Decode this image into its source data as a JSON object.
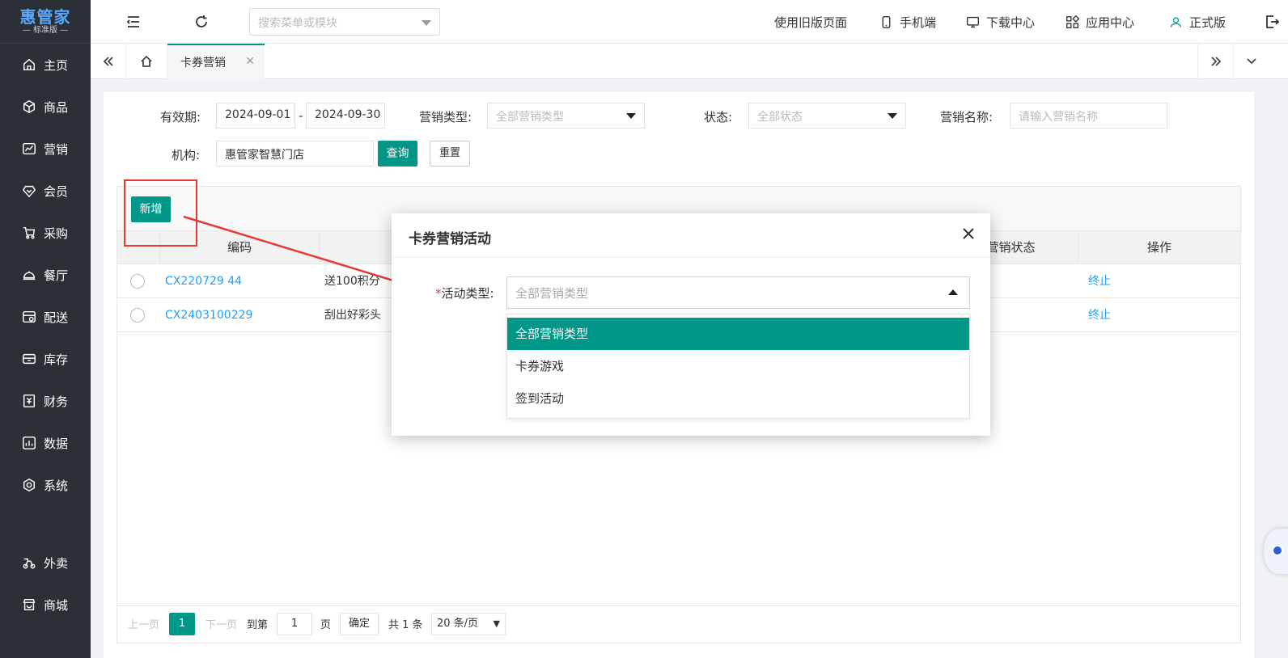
{
  "brand": {
    "name": "惠管家",
    "edition": "— 标准版 —"
  },
  "sidebar": {
    "items": [
      {
        "label": "主页",
        "icon": "home-icon"
      },
      {
        "label": "商品",
        "icon": "box-icon"
      },
      {
        "label": "营销",
        "icon": "chart-icon"
      },
      {
        "label": "会员",
        "icon": "member-icon"
      },
      {
        "label": "采购",
        "icon": "cart-icon"
      },
      {
        "label": "餐厅",
        "icon": "dish-icon"
      },
      {
        "label": "配送",
        "icon": "delivery-icon"
      },
      {
        "label": "库存",
        "icon": "inventory-icon"
      },
      {
        "label": "财务",
        "icon": "finance-icon"
      },
      {
        "label": "数据",
        "icon": "data-icon"
      },
      {
        "label": "系统",
        "icon": "settings-icon"
      },
      {
        "label": "外卖",
        "icon": "takeout-icon"
      },
      {
        "label": "商城",
        "icon": "store-icon"
      }
    ]
  },
  "topbar": {
    "search_placeholder": "搜索菜单或模块",
    "old_page": "使用旧版页面",
    "mobile": "手机端",
    "download": "下载中心",
    "apps": "应用中心",
    "version": "正式版"
  },
  "tabs": {
    "active": "卡券营销"
  },
  "filters": {
    "validity_label": "有效期:",
    "date_start": "2024-09-01",
    "date_sep": "-",
    "date_end": "2024-09-30",
    "type_label": "营销类型:",
    "type_placeholder": "全部营销类型",
    "status_label": "状态:",
    "status_placeholder": "全部状态",
    "name_label": "营销名称:",
    "name_placeholder": "请输入营销名称",
    "org_label": "机构:",
    "org_value": "惠管家智慧门店",
    "query": "查询",
    "reset": "重置"
  },
  "table": {
    "add_button": "新增",
    "columns": {
      "code": "编码",
      "status": "营销状态",
      "action": "操作"
    },
    "rows": [
      {
        "code": "CX220729 44",
        "name": "送100积分",
        "action": "终止"
      },
      {
        "code": "CX2403100229",
        "name": "刮出好彩头",
        "action": "终止"
      }
    ]
  },
  "pager": {
    "prev": "上一页",
    "current": "1",
    "next": "下一页",
    "goto": "到第",
    "goto_value": "1",
    "page_unit": "页",
    "confirm": "确定",
    "total": "共 1 条",
    "per_page": "20 条/页"
  },
  "modal": {
    "title": "卡券营销活动",
    "required_mark": "*",
    "field_label": "活动类型:",
    "select_placeholder": "全部营销类型",
    "options": [
      "全部营销类型",
      "卡券游戏",
      "签到活动"
    ],
    "selected_index": 0
  },
  "colors": {
    "primary": "#009688",
    "link": "#1e9fff",
    "annotation": "#e53935",
    "sidebar": "#2b2f36"
  }
}
